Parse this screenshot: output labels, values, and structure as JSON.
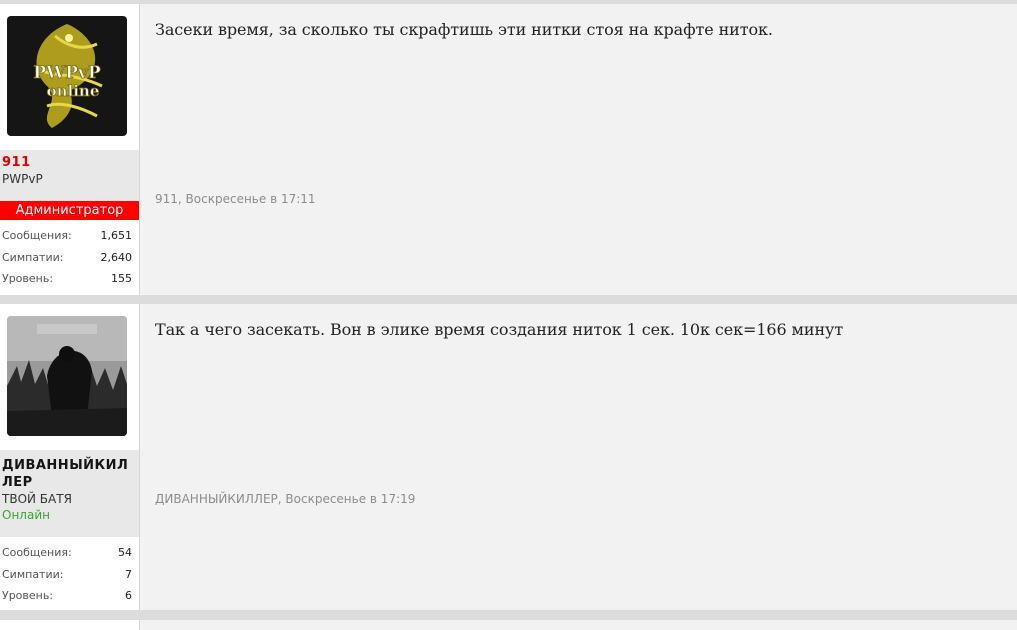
{
  "posts": [
    {
      "username": "911",
      "user_title": "PWPvP",
      "banner": "Администратор",
      "stats": [
        {
          "label": "Сообщения:",
          "value": "1,651"
        },
        {
          "label": "Симпатии:",
          "value": "2,640"
        },
        {
          "label": "Уровень:",
          "value": "155"
        }
      ],
      "message": "Засеки время, за сколько ты скрафтишь эти нитки стоя на крафте ниток.",
      "meta_author": "911",
      "meta_sep": ", ",
      "meta_time": "Воскресенье в 17:11",
      "avatar_text_1": "PWPvP",
      "avatar_text_2": "online"
    },
    {
      "username_line1": "ДИВАННЫЙКИЛ",
      "username_line2": "ЛЕР",
      "user_title": "ТВОЙ БАТЯ",
      "status": "Онлайн",
      "stats": [
        {
          "label": "Сообщения:",
          "value": "54"
        },
        {
          "label": "Симпатии:",
          "value": "7"
        },
        {
          "label": "Уровень:",
          "value": "6"
        }
      ],
      "message": "Так а чего засекать. Вон в элике время создания ниток 1 сек. 10к сек=166 минут",
      "meta_author": "ДИВАННЫЙКИЛЛЕР",
      "meta_sep": ", ",
      "meta_time": "Воскресенье в 17:19"
    }
  ],
  "colors": {
    "admin_banner": "#ff0000",
    "username_admin": "#e00000",
    "online": "#3aa52e"
  }
}
